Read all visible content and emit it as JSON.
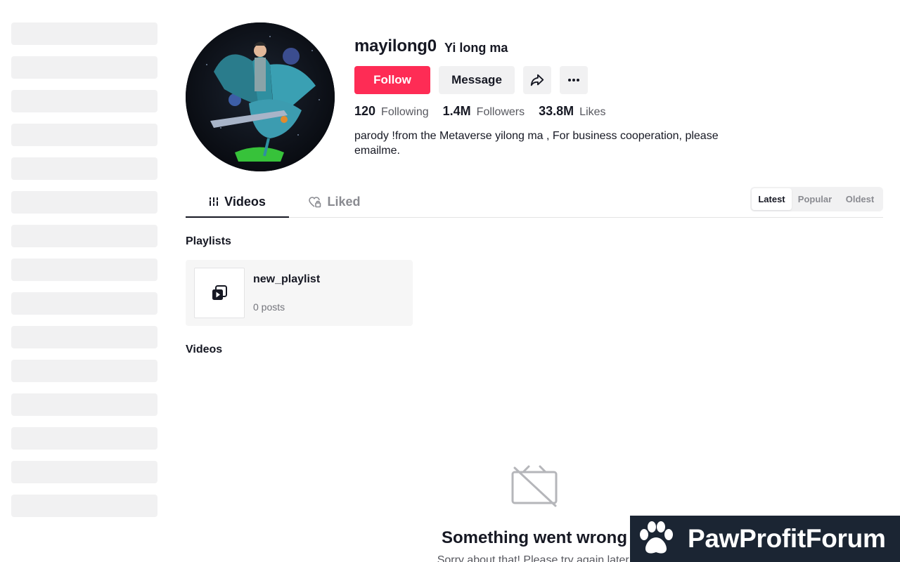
{
  "profile": {
    "username": "mayilong0",
    "nickname": "Yi long ma",
    "bio": "parody !from the Metaverse yilong ma , For business cooperation, please emailme."
  },
  "actions": {
    "follow_label": "Follow",
    "message_label": "Message",
    "share_icon": "share-icon",
    "more_icon": "more-icon"
  },
  "stats": [
    {
      "value": "120",
      "label": "Following"
    },
    {
      "value": "1.4M",
      "label": "Followers"
    },
    {
      "value": "33.8M",
      "label": "Likes"
    }
  ],
  "tabs": [
    {
      "label": "Videos",
      "icon": "grid-icon",
      "active": true
    },
    {
      "label": "Liked",
      "icon": "heart-lock-icon",
      "active": false
    }
  ],
  "sort": [
    {
      "label": "Latest",
      "active": true
    },
    {
      "label": "Popular",
      "active": false
    },
    {
      "label": "Oldest",
      "active": false
    }
  ],
  "playlists_section": {
    "title": "Playlists",
    "items": [
      {
        "name": "new_playlist",
        "count": "0 posts",
        "icon": "playlist-icon"
      }
    ]
  },
  "videos_section": {
    "title": "Videos",
    "error_title": "Something went wrong",
    "error_message": "Sorry about that! Please try again later."
  },
  "watermark": {
    "text": "PawProfitForum",
    "icon": "paw-icon"
  },
  "colors": {
    "primary": "#fe2c55",
    "text": "#161823",
    "muted": "#57585f",
    "skeleton": "#f1f1f2",
    "watermark_bg": "#1b2533"
  }
}
